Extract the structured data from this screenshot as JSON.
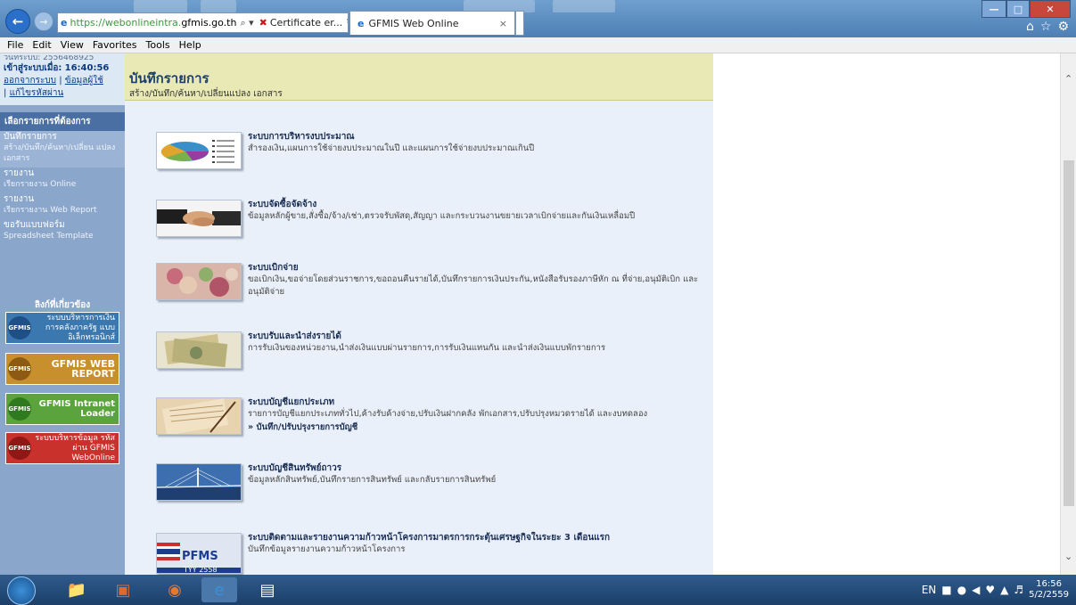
{
  "browser": {
    "address_prefix": "https://webonlineintra.",
    "address_domain": "gfmis.go.th",
    "address_controls": "⌕ ▾",
    "cert_text": "Certificate er...",
    "refresh": "↻",
    "tab_title": "GFMIS Web Online",
    "tab_close": "×"
  },
  "menubar": [
    "File",
    "Edit",
    "View",
    "Favorites",
    "Tools",
    "Help"
  ],
  "sidebar": {
    "cut_text": "วันที่ระบบ: 2556468925",
    "login_label": "เข้าสู่ระบบเมื่อ:",
    "login_time": "16:40:56",
    "link_logout": "ออกจากระบบ",
    "link_userinfo": "ข้อมูลผู้ใช้",
    "link_password": "แก้ไขรหัสผ่าน",
    "section_title": "เลือกรายการที่ต้องการ",
    "items": [
      {
        "title": "บันทึกรายการ",
        "desc": "สร้าง/บันทึก/ค้นหา/เปลี่ยน แปลง เอกสาร"
      },
      {
        "title": "รายงาน",
        "desc": "เรียกรายงาน Online"
      },
      {
        "title": "รายงาน",
        "desc": "เรียกรายงาน Web Report"
      },
      {
        "title": "ขอรับแบบฟอร์ม",
        "desc": "Spreadsheet Template"
      }
    ],
    "links_title": "ลิงก์ที่เกี่ยวข้อง",
    "banners": [
      {
        "logo": "GFMIS",
        "text": "ระบบบริหารการเงิน การคลังภาครัฐ แบบอิเล็กทรอนิกส์"
      },
      {
        "logo": "GFMIS",
        "text": "GFMIS WEB REPORT"
      },
      {
        "logo": "GFMIS",
        "text": "GFMIS Intranet Loader"
      },
      {
        "logo": "GFMIS",
        "text": "ระบบบริหารข้อมูล รหัสผ่าน GFMIS WebOnline"
      }
    ]
  },
  "main": {
    "title": "บันทึกรายการ",
    "subtitle": "สร้าง/บันทึก/ค้นหา/เปลี่ยนแปลง เอกสาร",
    "items": [
      {
        "title": "ระบบการบริหารงบประมาณ",
        "desc": "สำรองเงิน,แผนการใช้จ่ายงบประมาณในปี และแผนการใช้จ่ายงบประมาณเกินปี",
        "link": ""
      },
      {
        "title": "ระบบจัดซื้อจัดจ้าง",
        "desc": "ข้อมูลหลักผู้ขาย,สั่งซื้อ/จ้าง/เช่า,ตรวจรับพัสดุ,สัญญา และกระบวนงานขยายเวลาเบิกจ่ายและกันเงินเหลื่อมปี",
        "link": ""
      },
      {
        "title": "ระบบเบิกจ่าย",
        "desc": "ขอเบิกเงิน,ขอจ่ายโดยส่วนราชการ,ขอถอนคืนรายได้,บันทึกรายการเงินประกัน,หนังสือรับรองภาษีหัก ณ ที่จ่าย,อนุมัติเบิก และอนุมัติจ่าย",
        "link": ""
      },
      {
        "title": "ระบบรับและนำส่งรายได้",
        "desc": "การรับเงินของหน่วยงาน,นำส่งเงินแบบผ่านรายการ,การรับเงินแทนกัน และนำส่งเงินแบบพักรายการ",
        "link": ""
      },
      {
        "title": "ระบบบัญชีแยกประเภท",
        "desc": "รายการบัญชีแยกประเภททั่วไป,ค้างรับค้างจ่าย,ปรับเงินฝากคลัง พักเอกสาร,ปรับปรุงหมวดรายได้ และงบทดลอง",
        "link": "» บันทึก/ปรับปรุงรายการบัญชี"
      },
      {
        "title": "ระบบบัญชีสินทรัพย์ถาวร",
        "desc": "ข้อมูลหลักสินทรัพย์,บันทึกรายการสินทรัพย์ และกลับรายการสินทรัพย์",
        "link": ""
      },
      {
        "title": "ระบบติดตามและรายงานความก้าวหน้าโครงการมาตรการกระตุ้นเศรษฐกิจในระยะ 3 เดือนแรก",
        "desc": "บันทึกข้อมูลรายงานความก้าวหน้าโครงการ",
        "link": ""
      }
    ],
    "pfms_text": "PFMS",
    "pfms_sub": "TYY 2558"
  },
  "taskbar": {
    "lang": "EN",
    "time": "16:56",
    "date": "5/2/2559"
  },
  "icons": {
    "back": "back-arrow-icon",
    "forward": "forward-arrow-icon",
    "home": "home-icon",
    "favorites": "star-icon",
    "settings": "gear-icon"
  }
}
